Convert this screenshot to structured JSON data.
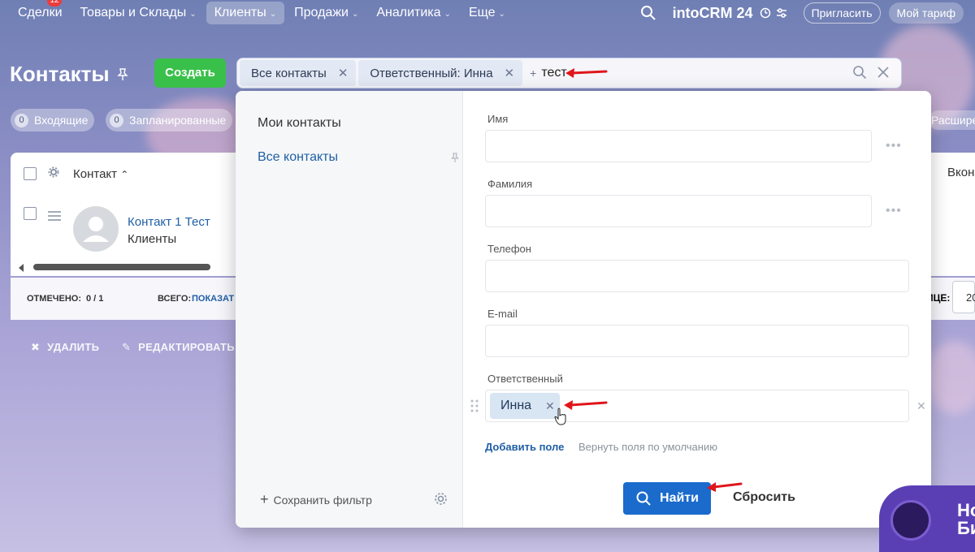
{
  "nav": {
    "items": [
      {
        "label": "Сделки",
        "badge": "12",
        "chevron": false
      },
      {
        "label": "Товары и Склады",
        "chevron": true
      },
      {
        "label": "Клиенты",
        "chevron": true,
        "active": true
      },
      {
        "label": "Продажи",
        "chevron": true
      },
      {
        "label": "Аналитика",
        "chevron": true
      },
      {
        "label": "Еще",
        "chevron": true
      }
    ],
    "brand": "intoCRM 24",
    "invite_label": "Пригласить",
    "tariff_label": "Мой тариф"
  },
  "header": {
    "title": "Контакты",
    "create_label": "Создать"
  },
  "filter": {
    "chips": [
      "Все контакты",
      "Ответственный: Инна"
    ],
    "query": "тест",
    "plus": "+"
  },
  "counters": [
    {
      "count": "0",
      "label": "Входящие"
    },
    {
      "count": "0",
      "label": "Запланированные"
    }
  ],
  "expand_label": "Расшире",
  "list": {
    "column_contact": "Контакт",
    "row": {
      "name": "Контакт 1 Тест",
      "type": "Клиенты"
    },
    "right_column": "Вкон",
    "selected_label": "ОТМЕЧЕНО:",
    "selected_value": "0 / 1",
    "total_label": "ВСЕГО:",
    "total_value": "ПОКАЗАТ",
    "page_label": "ИЦЕ:",
    "page_value": "20"
  },
  "actions": {
    "delete": "УДАЛИТЬ",
    "edit": "РЕДАКТИРОВАТЬ"
  },
  "popup": {
    "presets": [
      "Мои контакты",
      "Все контакты"
    ],
    "fields": {
      "name": "Имя",
      "surname": "Фамилия",
      "phone": "Телефон",
      "email": "E-mail",
      "responsible": "Ответственный"
    },
    "responsible_value": "Инна",
    "add_field": "Добавить поле",
    "restore_fields": "Вернуть поля по умолчанию",
    "find": "Найти",
    "reset": "Сбросить",
    "save_filter": "Сохранить фильтр"
  },
  "promo": {
    "line1": "Но",
    "line2": "Би"
  },
  "colors": {
    "accent": "#1a6bcc",
    "create": "#39c04a",
    "arrow": "#e0161b",
    "link": "#1f5fa5"
  }
}
